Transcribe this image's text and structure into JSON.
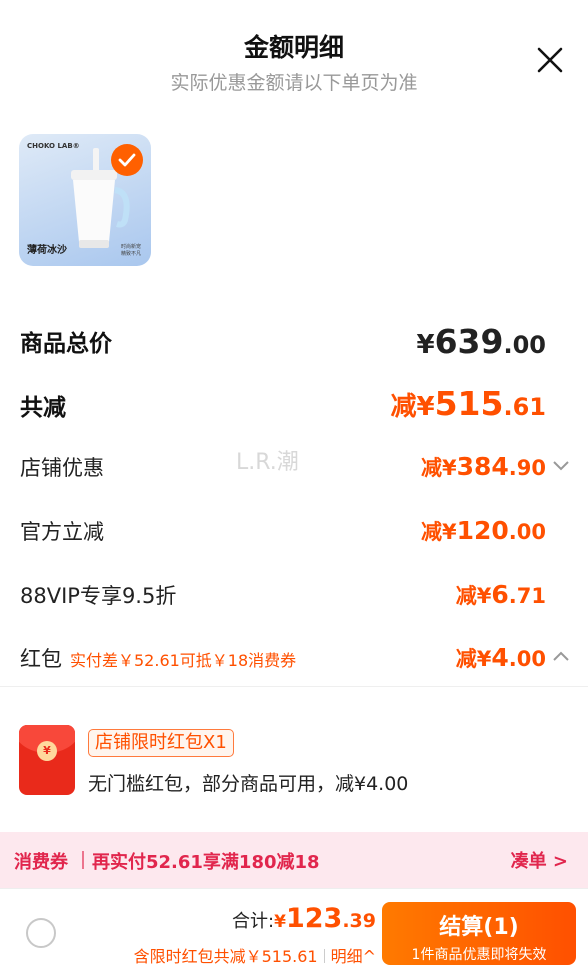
{
  "header": {
    "title": "金额明细",
    "subtitle": "实际优惠金额请以下单页为准"
  },
  "product": {
    "brand": "CHOKO LAB®",
    "caption": "薄荷冰沙",
    "tag": "时尚新宠 精致不凡"
  },
  "watermark": "L.R.潮",
  "rows": {
    "total": {
      "label": "商品总价",
      "currency": "¥",
      "int": "639",
      "dec": ".00"
    },
    "discount": {
      "label": "共减",
      "prefix": "减¥",
      "int": "515",
      "dec": ".61"
    },
    "store": {
      "label": "店铺优惠",
      "prefix": "减¥",
      "int": "384",
      "dec": ".90"
    },
    "official": {
      "label": "官方立减",
      "prefix": "减¥",
      "int": "120",
      "dec": ".00"
    },
    "vip": {
      "label": "88VIP专享9.5折",
      "prefix": "减¥",
      "int": "6",
      "dec": ".71"
    },
    "redpack": {
      "label": "红包",
      "note": "实付差￥52.61可抵￥18消费券",
      "prefix": "减¥",
      "int": "4",
      "dec": ".00"
    }
  },
  "coupon": {
    "coin": "¥",
    "tag": "店铺限时红包X1",
    "desc": "无门槛红包，部分商品可用，减¥4.00"
  },
  "xfq": {
    "label": "消费券",
    "text": "再实付52.61享满180减18",
    "action": "凑单 >"
  },
  "bottom": {
    "total_label": "合计:",
    "currency": "¥",
    "int": "123",
    "dec": ".39",
    "detail_note": "含限时红包共减￥515.61",
    "detail_link": "明细^",
    "checkout_label": "结算(1)",
    "checkout_sub": "1件商品优惠即将失效"
  },
  "colors": {
    "accent": "#ff5000",
    "xfq": "#e1264d",
    "xfq_bg": "#fde8ee"
  }
}
